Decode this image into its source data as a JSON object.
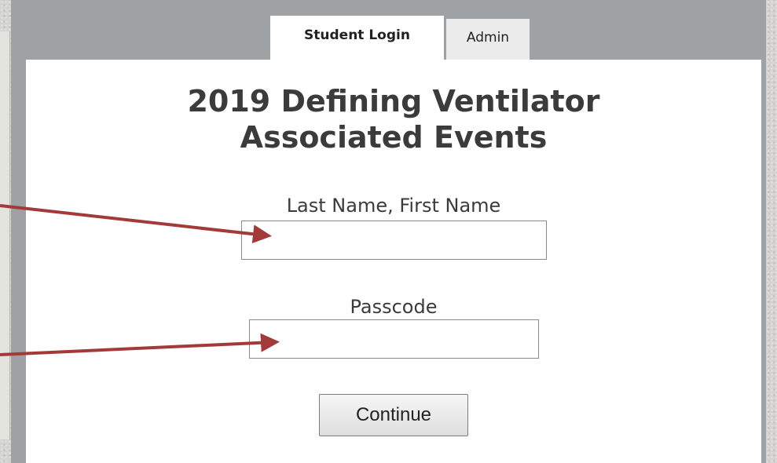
{
  "tabs": {
    "student_login": "Student Login",
    "admin": "Admin"
  },
  "title": {
    "line1": "2019 Defining Ventilator",
    "line2": "Associated Events"
  },
  "form": {
    "name_label": "Last Name, First Name",
    "name_value": "",
    "passcode_label": "Passcode",
    "passcode_value": "",
    "continue_label": "Continue"
  },
  "annotations": {
    "arrow_color": "#a33a3a"
  }
}
